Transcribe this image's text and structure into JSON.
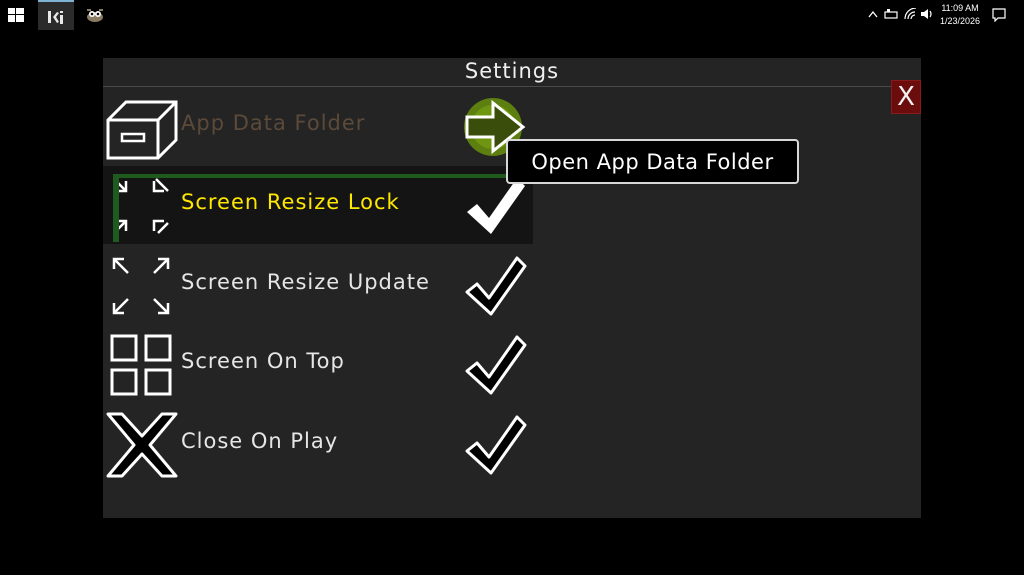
{
  "taskbar": {
    "apps": [
      {
        "name": "lkj",
        "active": true
      },
      {
        "name": "gimp",
        "active": false
      }
    ],
    "clock": {
      "time": "11:09 AM",
      "date": "1/23/2026"
    }
  },
  "window": {
    "title": "Settings",
    "close_label": "X",
    "rows": [
      {
        "label": "App Data Folder",
        "icon": "drawer-icon",
        "action": "arrow-right-icon"
      },
      {
        "label": "Screen Resize Lock",
        "icon": "arrows-inward-icon",
        "action": "checkmark-icon"
      },
      {
        "label": "Screen Resize Update",
        "icon": "arrows-outward-icon",
        "action": "checkmark-icon"
      },
      {
        "label": "Screen On Top",
        "icon": "grid-icon",
        "action": "checkmark-icon"
      },
      {
        "label": "Close On Play",
        "icon": "x-cross-icon",
        "action": "checkmark-icon"
      }
    ],
    "tooltip": "Open App Data Folder"
  },
  "colors": {
    "highlight": "#ffe800",
    "dim_label": "#5b4a3a",
    "close_button": "#6b0d0d",
    "arrow_glow": "#6a8a12"
  }
}
